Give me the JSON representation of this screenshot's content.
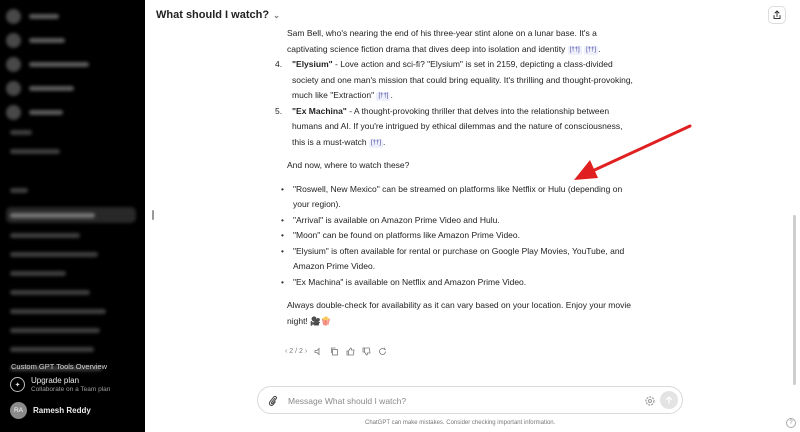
{
  "header": {
    "title": "What should I watch?"
  },
  "sidebar": {
    "hover_title": "Custom GPT Tools Overview",
    "upgrade": {
      "title": "Upgrade plan",
      "subtitle": "Collaborate on a Team plan"
    },
    "user": {
      "initials": "RA",
      "name": "Ramesh Reddy"
    }
  },
  "content": {
    "intro": "Sam Bell, who's nearing the end of his three-year stint alone on a lunar base. It's a captivating science fiction drama that dives deep into isolation and identity",
    "intro_cites": [
      "[††]",
      "[††]"
    ],
    "list": [
      {
        "num": "4.",
        "title": "\"Elysium\"",
        "text": " - Love action and sci-fi? \"Elysium\" is set in 2159, depicting a class-divided society and one man's mission that could bring equality. It's thrilling and thought-provoking, much like \"Extraction\"",
        "cite": "[††]"
      },
      {
        "num": "5.",
        "title": "\"Ex Machina\"",
        "text": " - A thought-provoking thriller that delves into the relationship between humans and AI. If you're intrigued by ethical dilemmas and the nature of consciousness, this is a must-watch",
        "cite": "[††]"
      }
    ],
    "where_heading": "And now, where to watch these?",
    "bullets": [
      "\"Roswell, New Mexico\" can be streamed on platforms like Netflix or Hulu (depending on your region).",
      "\"Arrival\" is available on Amazon Prime Video and Hulu.",
      "\"Moon\" can be found on platforms like Amazon Prime Video.",
      "\"Elysium\" is often available for rental or purchase on Google Play Movies, YouTube, and Amazon Prime Video.",
      "\"Ex Machina\" is available on Netflix and Amazon Prime Video."
    ],
    "closing": "Always double-check for availability as it can vary based on your location. Enjoy your movie night! 🎥🍿"
  },
  "actions": {
    "pager": "2 / 2"
  },
  "composer": {
    "placeholder": "Message What should I watch?"
  },
  "disclaimer": "ChatGPT can make mistakes. Consider checking important information.",
  "help_label": "?",
  "colors": {
    "sidebar_bg": "#000000",
    "arrow": "#e02020",
    "cite_bg": "#eef0fb"
  }
}
